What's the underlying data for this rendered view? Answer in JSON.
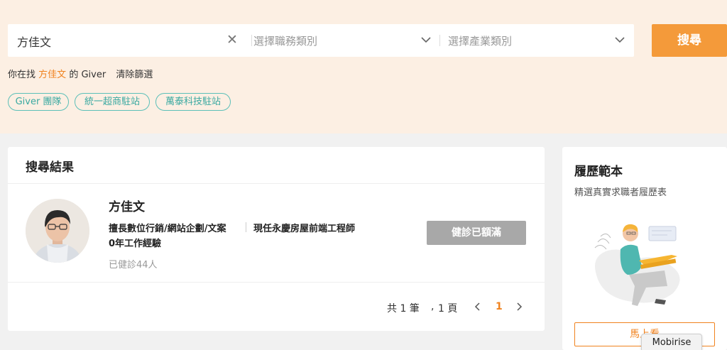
{
  "search": {
    "keyword": "方佳文",
    "job_category_placeholder": "選擇職務類別",
    "industry_placeholder": "選擇產業類別",
    "button_label": "搜尋"
  },
  "status": {
    "prefix": "你在找",
    "keyword": "方佳文",
    "suffix": "的 Giver",
    "clear_label": "清除篩選"
  },
  "tags": [
    "Giver 團隊",
    "統一超商駐站",
    "萬泰科技駐站"
  ],
  "results": {
    "title": "搜尋結果",
    "giver": {
      "name": "方佳文",
      "expertise": "擅長數位行銷/網站企劃/文案",
      "current": "現任永慶房屋前端工程師",
      "experience": "0年工作經驗",
      "count": "已健診44人",
      "status_button": "健診已額滿"
    },
    "pagination": {
      "summary_total": "共 1 筆",
      "summary_pages": "1 頁",
      "current_page": "1"
    }
  },
  "sidebar": {
    "title": "履歷範本",
    "subtitle": "精選真實求職者履歷表",
    "button_label": "馬上看"
  },
  "tooltip": "Mobirise",
  "colors": {
    "accent": "#f49a3a",
    "accent_text": "#f0821e",
    "tag": "#5bbfb8",
    "disabled": "#a8a8a8",
    "band": "#fcefe3"
  }
}
